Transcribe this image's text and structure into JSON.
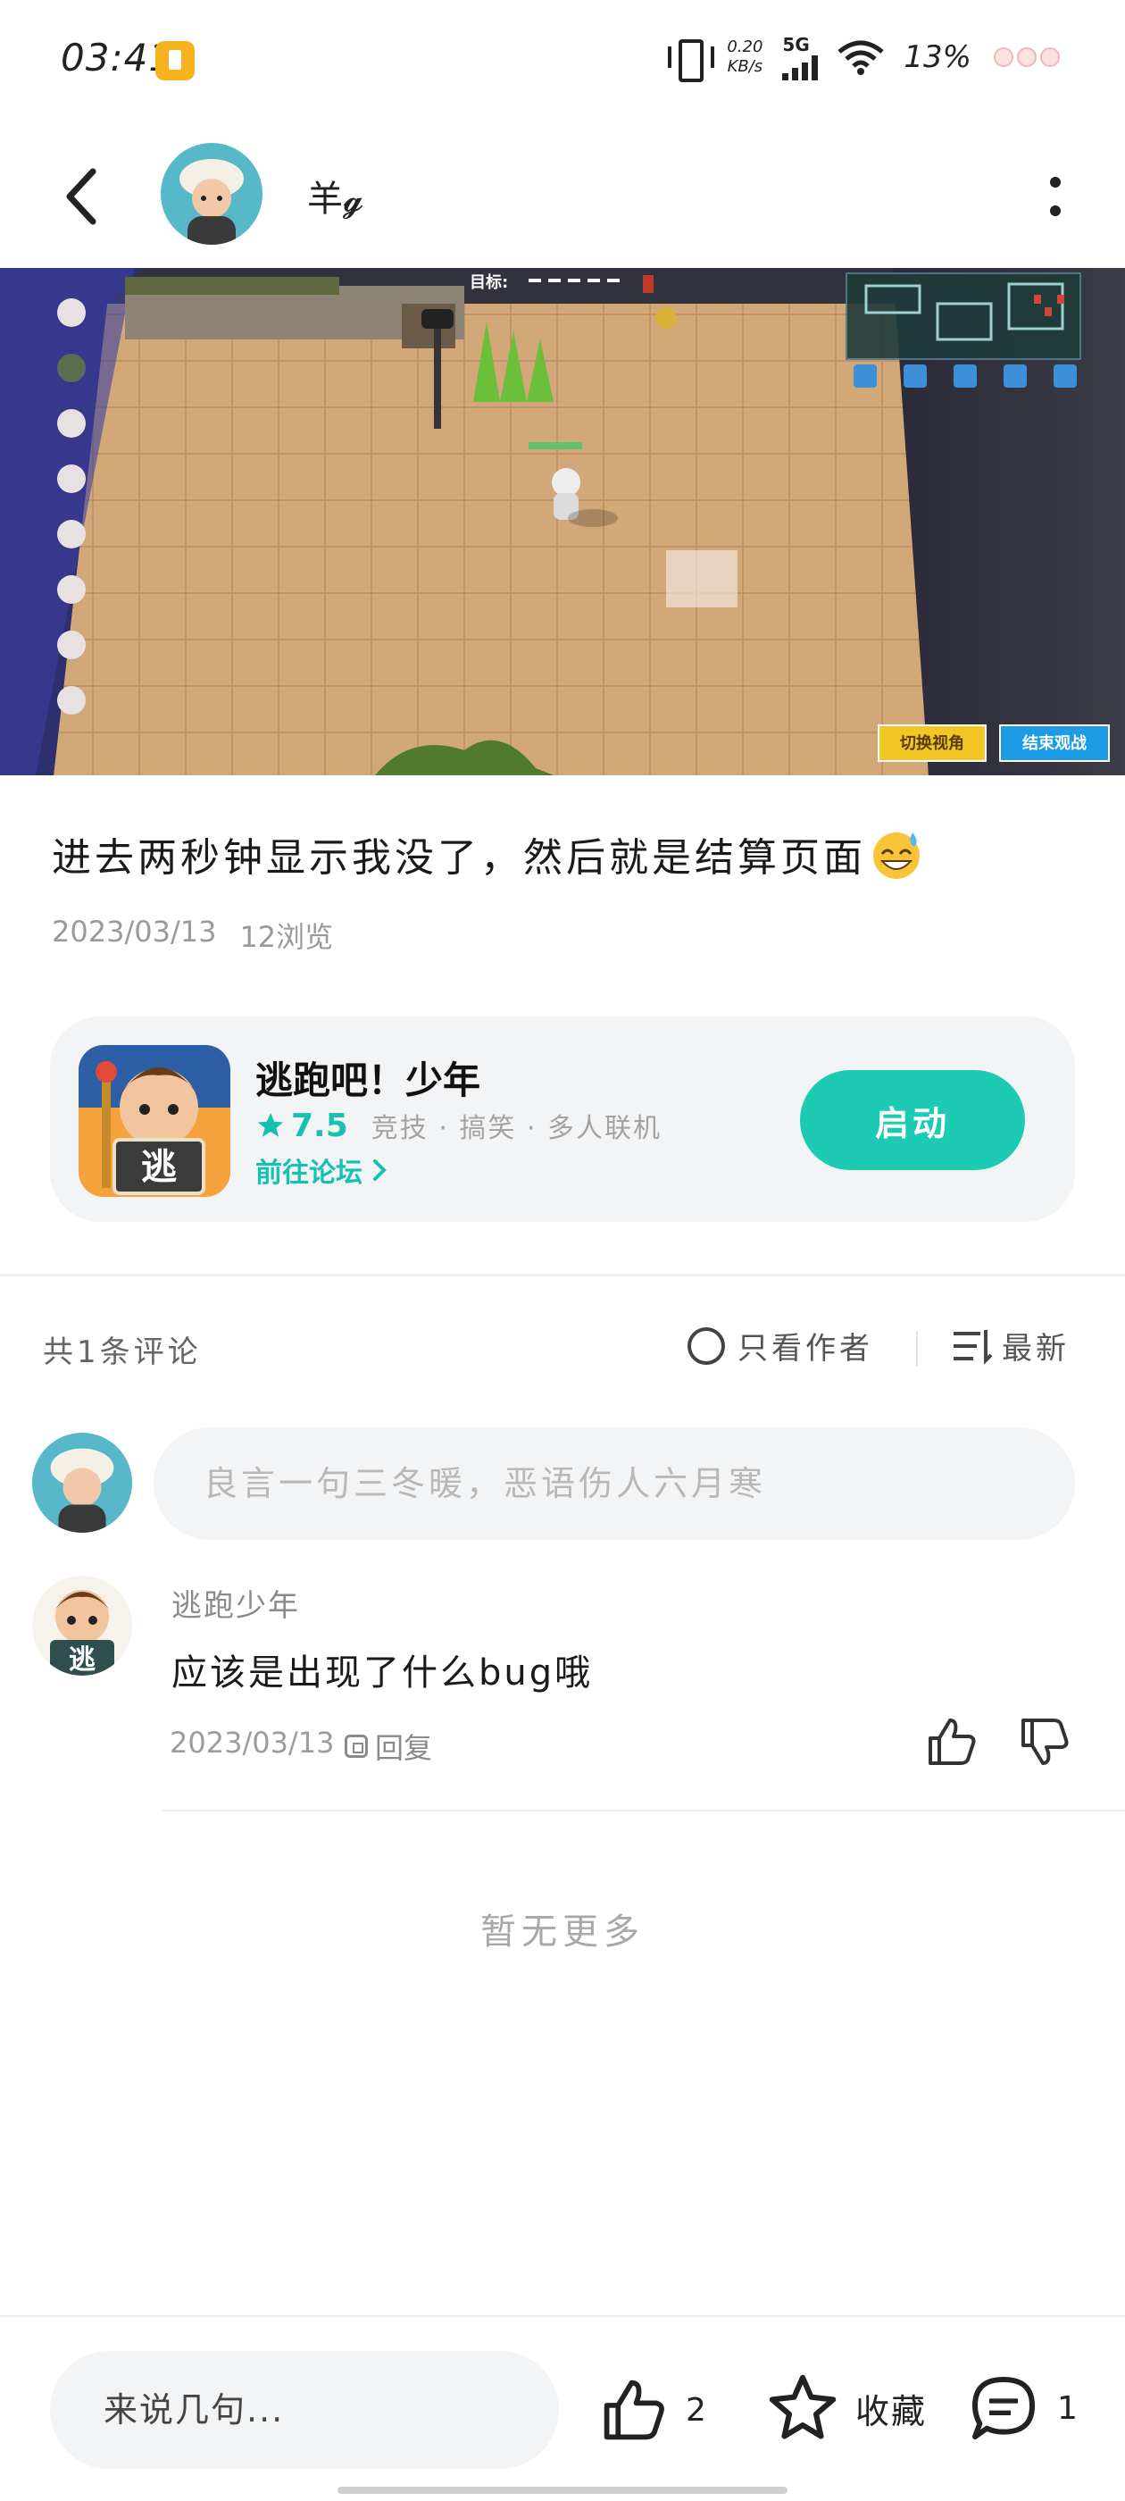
{
  "status_bar": {
    "time": "03:41",
    "net_speed_value": "0.20",
    "net_speed_unit": "KB/s",
    "network": "5G",
    "battery": "13%"
  },
  "header": {
    "author_name": "羊𝓰"
  },
  "post": {
    "text": "进去两秒钟显示我没了，然后就是结算页面",
    "date": "2023/03/13",
    "views": "12浏览",
    "game_overlay": {
      "target_label": "目标:",
      "switch_view": "切换视角",
      "end_spectate": "结束观战"
    }
  },
  "game_card": {
    "title": "逃跑吧！少年",
    "rating": "7.5",
    "tags": "竞技 · 搞笑 · 多人联机",
    "forum_link": "前往论坛",
    "launch": "启动",
    "icon_letter": "逃"
  },
  "comments_header": {
    "count": "共1条评论",
    "author_only": "只看作者",
    "sort": "最新"
  },
  "comment_input": {
    "placeholder": "良言一句三冬暖，恶语伤人六月寒"
  },
  "comments": [
    {
      "name": "逃跑少年",
      "text": "应该是出现了什么bug哦",
      "date": "2023/03/13",
      "reply": "回复",
      "avatar_letter": "逃"
    }
  ],
  "no_more": "暂无更多",
  "bottom_bar": {
    "placeholder": "来说几句...",
    "likes": "2",
    "favorite": "收藏",
    "comments": "1"
  },
  "colors": {
    "accent": "#1dcbb4",
    "rating": "#17c1b0"
  }
}
